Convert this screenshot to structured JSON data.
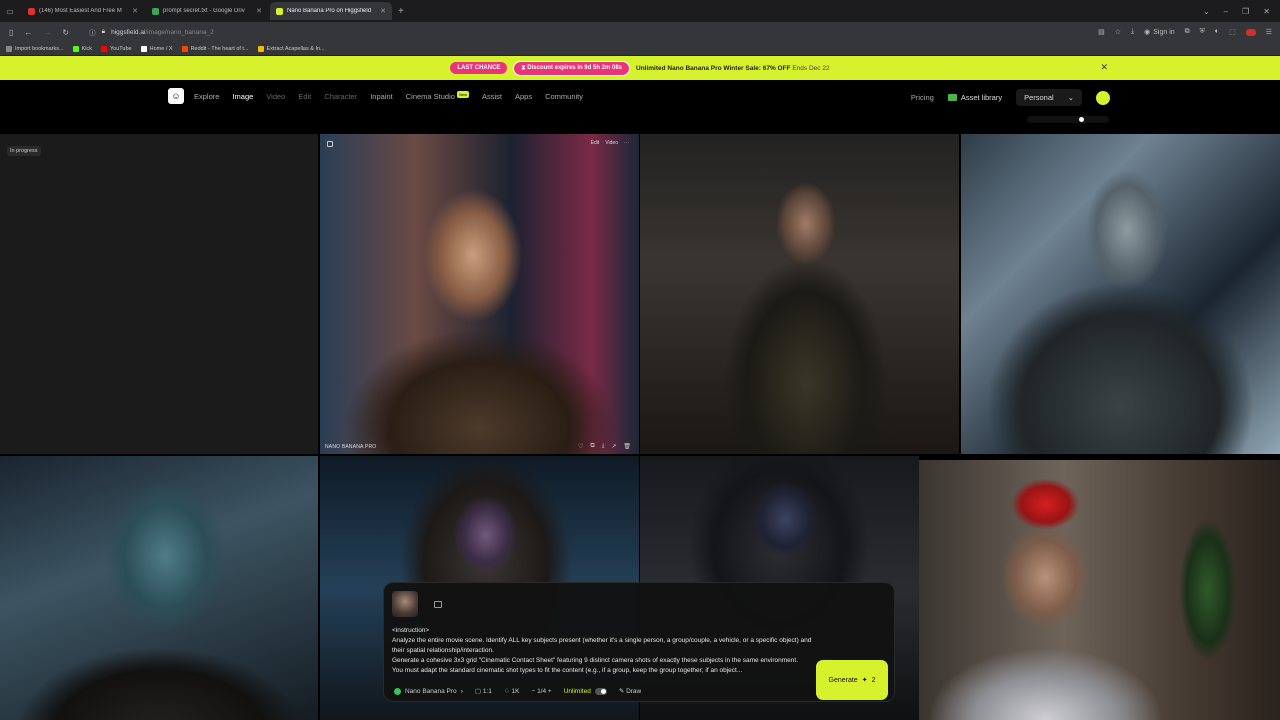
{
  "browser": {
    "tabs": [
      {
        "label": "(146) Most Easiest And Free M",
        "color": "#e03030"
      },
      {
        "label": "prompt secret.txt - Google Driv",
        "color": "#3aa757"
      },
      {
        "label": "Nano Banana Pro on Higgsfield",
        "color": "#d6f22c"
      }
    ],
    "url_host": "higgsfield.ai",
    "url_path": "/image/nano_banana_2",
    "signin_label": "Sign in",
    "bookmarks": [
      {
        "label": "Import bookmarks...",
        "color": "#888888"
      },
      {
        "label": "Kick",
        "color": "#53fc18"
      },
      {
        "label": "YouTube",
        "color": "#ff0000"
      },
      {
        "label": "Home / X",
        "color": "#ffffff"
      },
      {
        "label": "Reddit - The heart of t...",
        "color": "#ff4500"
      },
      {
        "label": "Extract Acapellas & In...",
        "color": "#f0c000"
      }
    ]
  },
  "promo": {
    "badge": "LAST CHANCE",
    "timer": "Discount expires in 9d 5h 2m 08s",
    "text": "Unlimited Nano Banana Pro",
    "text_detail": "Winter Sale: 67% OFF",
    "ends": "Ends Dec 22"
  },
  "nav": {
    "links": [
      "Explore",
      "Image",
      "Video",
      "Edit",
      "Character",
      "Inpaint",
      "Cinema Studio",
      "Assist",
      "Apps",
      "Community"
    ],
    "new_badge": "New",
    "pricing": "Pricing",
    "asset_library": "Asset library",
    "workspace": "Personal",
    "size_slider_value": 0.67
  },
  "gallery": {
    "in_progress_label": "In progress",
    "hover_actions": [
      "Edit",
      "Video"
    ],
    "model_watermark": "NANO BANANA PRO"
  },
  "prompt": {
    "lines": [
      "<instruction>",
      "Analyze the entire movie scene. Identify ALL key subjects present (whether it's a single person, a group/couple, a vehicle, or a specific object) and their spatial relationship/interaction.",
      "Generate a cohesive 3x3 grid \"Cinematic Contact Sheet\" featuring 9 distinct camera shots of exactly these subjects in the same environment.",
      "You must adapt the standard cinematic shot types to fit the content (e.g., if a group, keep the group together; if an object..."
    ],
    "model": "Nano Banana Pro",
    "aspect": "1:1",
    "resolution": "1K",
    "count": "1/4",
    "unlimited": "Unlimited",
    "draw": "Draw",
    "generate": "Generate",
    "generate_cost": "2"
  },
  "colors": {
    "accent": "#d6f22c",
    "promo_pink": "#e9347a"
  }
}
